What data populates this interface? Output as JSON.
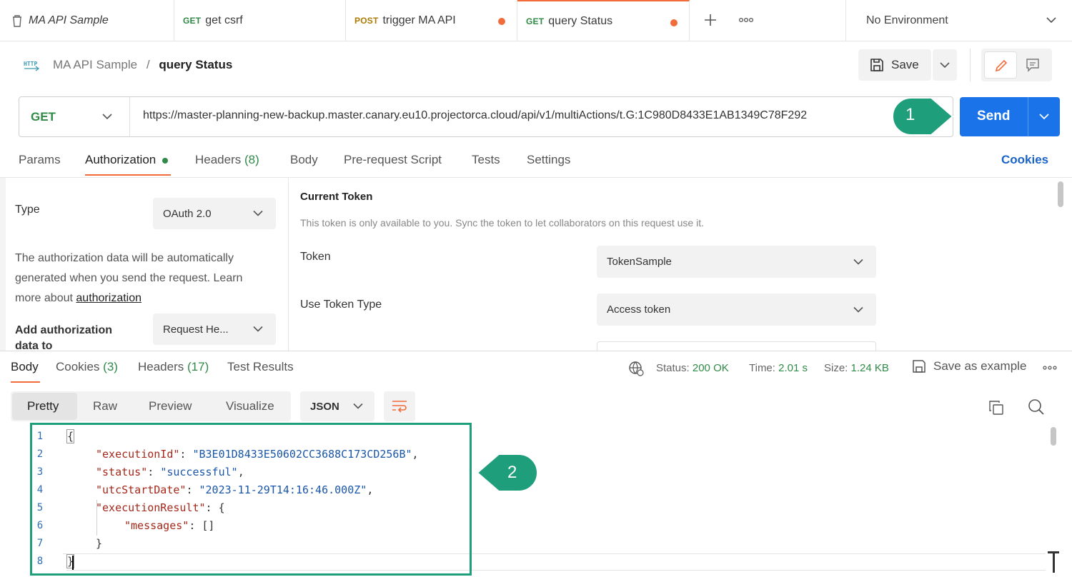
{
  "tabs": [
    {
      "method": "",
      "label": "MA API Sample",
      "italic": true
    },
    {
      "method": "GET",
      "label": "get csrf"
    },
    {
      "method": "POST",
      "label": "trigger MA API",
      "dirty": true
    },
    {
      "method": "GET",
      "label": "query Status",
      "dirty": true,
      "active": true
    }
  ],
  "environment": "No Environment",
  "breadcrumb": {
    "collection": "MA API Sample",
    "separator": "/",
    "request": "query Status"
  },
  "save_label": "Save",
  "request": {
    "method": "GET",
    "url": "https://master-planning-new-backup.master.canary.eu10.projectorca.cloud/api/v1/multiActions/t.G:1C980D8433E1AB1349C78F292"
  },
  "send_label": "Send",
  "request_tabs": {
    "params": "Params",
    "authorization": "Authorization",
    "headers": "Headers",
    "headers_count": "(8)",
    "body": "Body",
    "prerequest": "Pre-request Script",
    "tests": "Tests",
    "settings": "Settings",
    "cookies": "Cookies"
  },
  "auth": {
    "type_label": "Type",
    "type_value": "OAuth 2.0",
    "description_line1": "The authorization data will be automatically",
    "description_line2": "generated when you send the request. Learn",
    "description_line3": "more about ",
    "description_link": "authorization",
    "add_to_label_line1": "Add authorization",
    "add_to_label_line2": "data to",
    "add_to_value": "Request He..."
  },
  "token": {
    "heading": "Current Token",
    "note": "This token is only available to you. Sync the token to let collaborators on this request use it.",
    "token_label": "Token",
    "token_value": "TokenSample",
    "type_label": "Use Token Type",
    "type_value": "Access token"
  },
  "response_tabs": {
    "body": "Body",
    "cookies": "Cookies",
    "cookies_count": "(3)",
    "headers": "Headers",
    "headers_count": "(17)",
    "tests": "Test Results"
  },
  "response_meta": {
    "status_label": "Status:",
    "status_value": "200 OK",
    "time_label": "Time:",
    "time_value": "2.01 s",
    "size_label": "Size:",
    "size_value": "1.24 KB",
    "save_example": "Save as example"
  },
  "view_modes": [
    "Pretty",
    "Raw",
    "Preview",
    "Visualize"
  ],
  "format": "JSON",
  "code_lines": [
    {
      "n": "1",
      "text": "{"
    },
    {
      "n": "2",
      "key": "\"executionId\"",
      "value": "\"B3E01D8433E50602CC3688C173CD256B\"",
      "tail": ","
    },
    {
      "n": "3",
      "key": "\"status\"",
      "value": "\"successful\"",
      "tail": ","
    },
    {
      "n": "4",
      "key": "\"utcStartDate\"",
      "value": "\"2023-11-29T14:16:46.000Z\"",
      "tail": ","
    },
    {
      "n": "5",
      "key": "\"executionResult\"",
      "value": "{",
      "tail": ""
    },
    {
      "n": "6",
      "key": "\"messages\"",
      "value": "[]",
      "tail": ""
    },
    {
      "n": "7",
      "text": "}"
    },
    {
      "n": "8",
      "text": "}"
    }
  ],
  "callouts": [
    "1",
    "2"
  ],
  "colors": {
    "accent": "#f26b3a",
    "send": "#1a73e8",
    "callout": "#1f9e7c",
    "ok": "#2f8a47"
  }
}
